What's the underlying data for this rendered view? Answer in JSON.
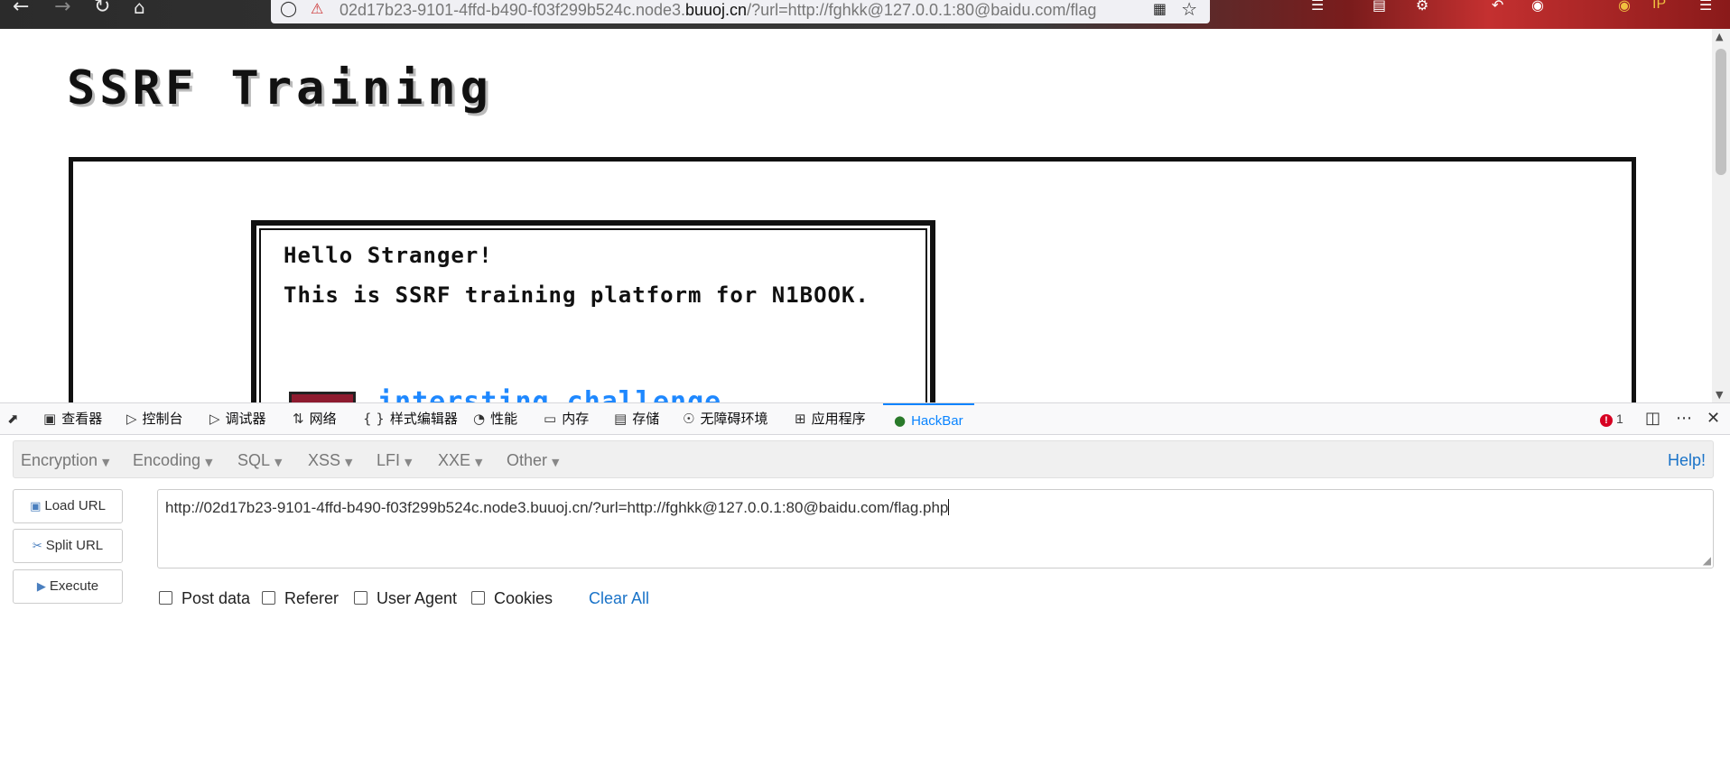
{
  "browser": {
    "nav": {
      "back_icon": "arrow-left-icon",
      "forward_icon": "arrow-right-icon",
      "reload_icon": "reload-icon",
      "home_icon": "home-icon"
    },
    "address": {
      "url_prefix": "02d17b23-9101-4ffd-b490-f03f299b524c.node3.",
      "url_domain": "buuoj.cn",
      "url_suffix": "/?url=http://fghkk@127.0.0.1:80@baidu.com/flag"
    },
    "extension_badge": "IP"
  },
  "page": {
    "title": "SSRF Training",
    "dialog": {
      "greeting": "Hello Stranger!",
      "intro": "This is SSRF training platform for N1BOOK.",
      "link_text": "intersting challenge"
    }
  },
  "devtools": {
    "tabs": [
      {
        "label": "查看器",
        "icon": "inspector-icon"
      },
      {
        "label": "控制台",
        "icon": "console-icon"
      },
      {
        "label": "调试器",
        "icon": "debugger-icon"
      },
      {
        "label": "网络",
        "icon": "network-icon"
      },
      {
        "label": "样式编辑器",
        "icon": "style-editor-icon"
      },
      {
        "label": "性能",
        "icon": "performance-icon"
      },
      {
        "label": "内存",
        "icon": "memory-icon"
      },
      {
        "label": "存储",
        "icon": "storage-icon"
      },
      {
        "label": "无障碍环境",
        "icon": "accessibility-icon"
      },
      {
        "label": "应用程序",
        "icon": "application-icon"
      },
      {
        "label": "HackBar",
        "icon": "hackbar-icon"
      }
    ],
    "active_tab": "HackBar",
    "error_count": "1",
    "accent_color": "#0a84ff"
  },
  "hackbar": {
    "menus": [
      "Encryption",
      "Encoding",
      "SQL",
      "XSS",
      "LFI",
      "XXE",
      "Other"
    ],
    "help_label": "Help!",
    "buttons": {
      "load": "Load URL",
      "split": "Split URL",
      "execute": "Execute"
    },
    "url_value": "http://02d17b23-9101-4ffd-b490-f03f299b524c.node3.buuoj.cn/?url=http://fghkk@127.0.0.1:80@baidu.com/flag.php",
    "options": {
      "post_data": "Post data",
      "referer": "Referer",
      "user_agent": "User Agent",
      "cookies": "Cookies"
    },
    "clear_all": "Clear All"
  }
}
